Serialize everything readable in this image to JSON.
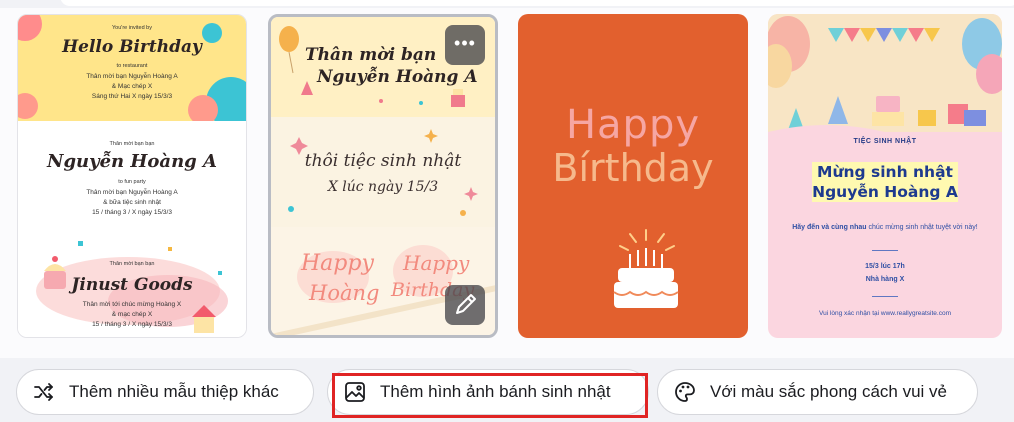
{
  "templates": [
    {
      "id": "card-1",
      "section1": {
        "invited": "You're invited by",
        "title": "Hello Birthday",
        "venue": "to restaurant",
        "lines": [
          "Thân mời bạn Nguyễn Hoàng A",
          "& Mạc chép X",
          "Sáng thứ Hai X ngày 15/3/3"
        ]
      },
      "section2": {
        "invited": "Thân mời bạn bạn",
        "title": "Nguyễn Hoàng A",
        "venue": "to fun party",
        "lines": [
          "Thân mời bạn Nguyễn Hoàng A",
          "& bữa tiệc sinh nhật",
          "15 / tháng 3 / X ngày 15/3/3"
        ]
      },
      "section3": {
        "invited": "Thân mời bạn bạn",
        "title": "Jinust Goods",
        "lines": [
          "Thân mời tới chúc mừng Hoàng X",
          "& mạc chép X",
          "15 / tháng 3 / X ngày 15/3/3"
        ]
      }
    },
    {
      "id": "card-2",
      "heading1": "Thân mời bạn",
      "heading2": "Nguyễn Hoàng A",
      "line1": "thôi tiệc sinh nhật",
      "line2": "X lúc ngày 15/3",
      "left_happy": "Happy",
      "left_name": "Hoàng",
      "right_happy": "Happy",
      "right_birthday": "Birthday",
      "more_label": "•••"
    },
    {
      "id": "card-3",
      "happy": "Happy",
      "birthday": "Bírthday"
    },
    {
      "id": "card-4",
      "label": "TIỆC SINH NHẬT",
      "title1": "Mừng sinh nhật",
      "title2": "Nguyễn Hoàng A",
      "sub_strong": "Hãy đến và cùng nhau",
      "sub_rest": " chúc mừng sinh nhật tuyệt vời này!",
      "time": "15/3 lúc 17h",
      "place": "Nhà hàng X",
      "footer": "Vui lòng xác nhận tại www.reallygreatsite.com"
    }
  ],
  "suggestions": [
    {
      "label": "Thêm nhiều mẫu thiệp khác",
      "icon": "shuffle-icon"
    },
    {
      "label": "Thêm hình ảnh bánh sinh nhật",
      "icon": "image-icon",
      "highlighted": true
    },
    {
      "label": "Với màu sắc phong cách vui vẻ",
      "icon": "palette-icon"
    }
  ],
  "colors": {
    "highlight": "#e02424",
    "card3_bg": "#e2602e",
    "card4_title": "#1e3a8f"
  }
}
